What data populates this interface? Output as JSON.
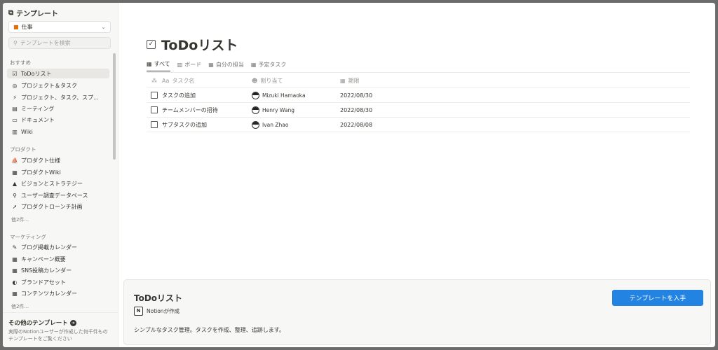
{
  "sidebar": {
    "title": "テンプレート",
    "category": "仕事",
    "search_placeholder": "テンプレートを検索",
    "sections": [
      {
        "label": "おすすめ",
        "items": [
          {
            "label": "ToDoリスト",
            "icon": "checkbox-icon",
            "glyph": "☑"
          },
          {
            "label": "プロジェクト＆タスク",
            "icon": "target-icon",
            "glyph": "◎"
          },
          {
            "label": "プロジェクト、タスク、スプ...",
            "icon": "runner-icon",
            "glyph": "⚡"
          },
          {
            "label": "ミーティング",
            "icon": "calendar-icon",
            "glyph": "▤"
          },
          {
            "label": "ドキュメント",
            "icon": "document-icon",
            "glyph": "▭"
          },
          {
            "label": "Wiki",
            "icon": "book-icon",
            "glyph": "▥"
          }
        ]
      },
      {
        "label": "プロダクト",
        "items": [
          {
            "label": "プロダクト仕様",
            "icon": "sailboat-icon",
            "glyph": "⛵"
          },
          {
            "label": "プロダクトWiki",
            "icon": "building-icon",
            "glyph": "▦"
          },
          {
            "label": "ビジョンとストラテジー",
            "icon": "mountain-icon",
            "glyph": "▲"
          },
          {
            "label": "ユーザー調査データベース",
            "icon": "telescope-icon",
            "glyph": "⚲"
          },
          {
            "label": "プロダクトローンチ計画",
            "icon": "rocket-icon",
            "glyph": "➚"
          }
        ],
        "more": "他2件..."
      },
      {
        "label": "マーケティング",
        "items": [
          {
            "label": "ブログ掲載カレンダー",
            "icon": "pencil-icon",
            "glyph": "✎"
          },
          {
            "label": "キャンペーン概要",
            "icon": "calendar-icon",
            "glyph": "▦"
          },
          {
            "label": "SNS投稿カレンダー",
            "icon": "calendar-icon",
            "glyph": "▦"
          },
          {
            "label": "ブランドアセット",
            "icon": "palette-icon",
            "glyph": "◐"
          },
          {
            "label": "コンテンツカレンダー",
            "icon": "calendar-icon",
            "glyph": "▦"
          }
        ],
        "more": "他2件..."
      }
    ],
    "other": {
      "title": "その他のテンプレート",
      "description": "実際のNotionユーザーが作成した何千件ものテンプレートをご覧ください"
    }
  },
  "preview": {
    "title": "ToDoリスト",
    "tabs": [
      "すべて",
      "ボード",
      "自分の担当",
      "予定タスク"
    ],
    "columns": [
      "タスク名",
      "割り当て",
      "期限"
    ],
    "column_prefix": "Aa",
    "rows": [
      {
        "task": "タスクの追加",
        "assignee": "Mizuki Hamaoka",
        "due": "2022/08/30"
      },
      {
        "task": "チームメンバーの招待",
        "assignee": "Henry Wang",
        "due": "2022/08/30"
      },
      {
        "task": "サブタスクの追加",
        "assignee": "Ivan Zhao",
        "due": "2022/08/08"
      }
    ]
  },
  "detail": {
    "title": "ToDoリスト",
    "author": "Notionが作成",
    "description": "シンプルなタスク管理。タスクを作成、整理、追跡します。",
    "button": "テンプレートを入手"
  },
  "colors": {
    "accent": "#2383e2",
    "sidebar_bg": "#f7f7f5"
  }
}
